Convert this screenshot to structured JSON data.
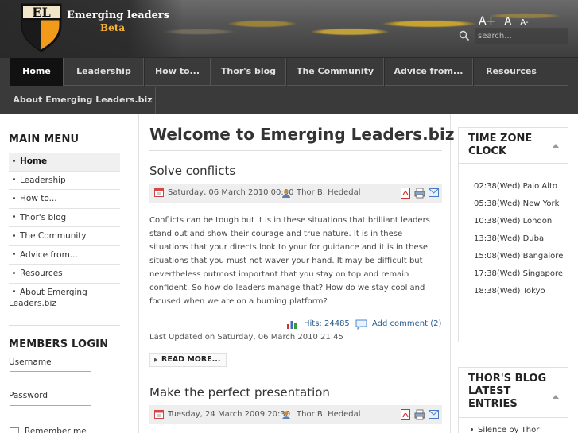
{
  "header": {
    "site_title": "Emerging leaders",
    "site_subtitle": "Beta",
    "logo_letters": "EL",
    "font_tools": {
      "increase": "A+",
      "reset": "A",
      "decrease": "A-"
    },
    "search": {
      "placeholder": "search..."
    }
  },
  "nav": {
    "items": [
      {
        "label": "Home",
        "active": true
      },
      {
        "label": "Leadership"
      },
      {
        "label": "How to..."
      },
      {
        "label": "Thor's blog"
      },
      {
        "label": "The Community"
      },
      {
        "label": "Advice from..."
      },
      {
        "label": "Resources"
      },
      {
        "label": "About Emerging Leaders.biz"
      }
    ]
  },
  "left": {
    "main_menu_title": "MAIN MENU",
    "menu": [
      {
        "label": "Home",
        "active": true
      },
      {
        "label": "Leadership"
      },
      {
        "label": "How to..."
      },
      {
        "label": "Thor's blog"
      },
      {
        "label": "The Community"
      },
      {
        "label": "Advice from..."
      },
      {
        "label": "Resources"
      },
      {
        "label": "About Emerging Leaders.biz"
      }
    ],
    "members_title": "MEMBERS LOGIN",
    "username_label": "Username",
    "password_label": "Password",
    "remember_label": "Remember me"
  },
  "main": {
    "heading": "Welcome to Emerging Leaders.biz",
    "articles": [
      {
        "title": "Solve conflicts",
        "date": "Saturday, 06 March 2010 00:00",
        "author": "Thor B. Hededal",
        "body": "Conflicts can be tough but it is in these situations that brilliant leaders stand out and show their courage and true nature. It is in these situations that your directs look to your for guidance and it is in these situations that you must not waver your hand. It may be difficult but nevertheless outmost important that you stay on top and remain confident. So how do leaders manage that? How do we stay cool and focused when we are on a burning platform?",
        "hits": "Hits: 24485",
        "comment": "Add comment (2)",
        "last_updated": "Last Updated on Saturday, 06 March 2010 21:45",
        "read_more": "READ MORE..."
      },
      {
        "title": "Make the perfect presentation",
        "date": "Tuesday, 24 March 2009 20:30",
        "author": "Thor B. Hededal"
      }
    ]
  },
  "right": {
    "timezone_title": "TIME ZONE CLOCK",
    "timezones": [
      "02:38(Wed) Palo Alto",
      "05:38(Wed) New York",
      "10:38(Wed) London",
      "13:38(Wed) Dubai",
      "15:08(Wed) Bangalore",
      "17:38(Wed) Singapore",
      "18:38(Wed) Tokyo"
    ],
    "blog_title": "THOR'S BLOG LATEST ENTRIES",
    "blog_entries": [
      "Silence by Thor"
    ]
  },
  "colors": {
    "accent_orange": "#f3b13a",
    "nav_bg": "#3a3a3a",
    "link": "#2a5d8f"
  }
}
